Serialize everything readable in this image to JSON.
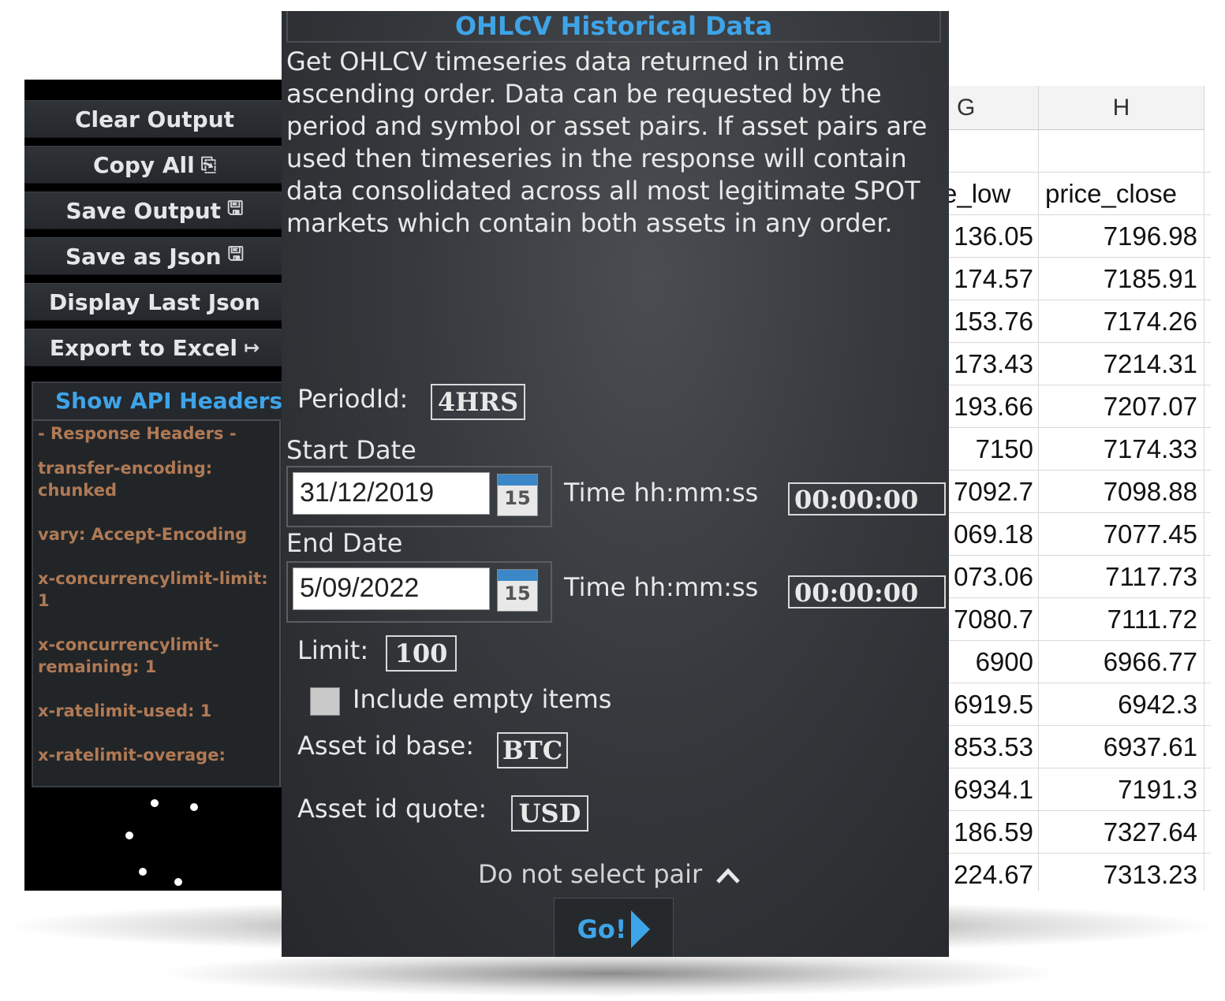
{
  "left_panel": {
    "buttons": [
      {
        "label": "Clear Output",
        "icon": ""
      },
      {
        "label": "Copy All",
        "icon": "⎘"
      },
      {
        "label": "Save Output",
        "icon": "🖫"
      },
      {
        "label": "Save as Json",
        "icon": "🖫"
      },
      {
        "label": "Display Last Json",
        "icon": ""
      },
      {
        "label": "Export to Excel",
        "icon": "↦"
      }
    ],
    "api_headers": {
      "toggle_label": "Show API Headers",
      "section_title": "- Response Headers -",
      "items": [
        "transfer-encoding: chunked",
        "vary: Accept-Encoding",
        "x-concurrencylimit-limit: 1",
        "x-concurrencylimit-remaining: 1",
        "x-ratelimit-used: 1",
        "x-ratelimit-overage: "
      ]
    }
  },
  "main": {
    "title": "OHLCV Historical Data",
    "description": "Get OHLCV timeseries data returned in time ascending order. Data can be requested by the period and symbol or asset pairs. If asset pairs are used then timeseries in the response will contain data consolidated across all most legitimate SPOT markets which contain both assets in any order.",
    "period": {
      "label": "PeriodId:",
      "value": "4HRS"
    },
    "start_date": {
      "label": "Start Date",
      "value": "31/12/2019",
      "time_label": "Time hh:mm:ss",
      "time_value": "00:00:00"
    },
    "end_date": {
      "label": "End Date",
      "value": "5/09/2022",
      "time_label": "Time hh:mm:ss",
      "time_value": "00:00:00"
    },
    "calendar_day": "15",
    "limit": {
      "label": "Limit:",
      "value": "100"
    },
    "include_empty": {
      "label": "Include empty items",
      "checked": false
    },
    "asset_base": {
      "label": "Asset id base:",
      "value": "BTC"
    },
    "asset_quote": {
      "label": "Asset id quote:",
      "value": "USD"
    },
    "pair_toggle": {
      "label": "Do not select pair",
      "icon": "chevron-up-icon"
    },
    "go_label": "Go!"
  },
  "spreadsheet": {
    "columns": [
      "G",
      "H"
    ],
    "field_headers": [
      "e_low",
      "price_close"
    ],
    "rows": [
      [
        "136.05",
        "7196.98"
      ],
      [
        "174.57",
        "7185.91"
      ],
      [
        "153.76",
        "7174.26"
      ],
      [
        "173.43",
        "7214.31"
      ],
      [
        "193.66",
        "7207.07"
      ],
      [
        "7150",
        "7174.33"
      ],
      [
        "7092.7",
        "7098.88"
      ],
      [
        "069.18",
        "7077.45"
      ],
      [
        "073.06",
        "7117.73"
      ],
      [
        "7080.7",
        "7111.72"
      ],
      [
        "6900",
        "6966.77"
      ],
      [
        "6919.5",
        "6942.3"
      ],
      [
        "853.53",
        "6937.61"
      ],
      [
        "6934.1",
        "7191.3"
      ],
      [
        "186.59",
        "7327.64"
      ],
      [
        "224.67",
        "7313.23"
      ]
    ]
  },
  "colors": {
    "accent": "#3ea4e8",
    "header_text": "#b07a55",
    "panel_bg": "#36393d"
  }
}
